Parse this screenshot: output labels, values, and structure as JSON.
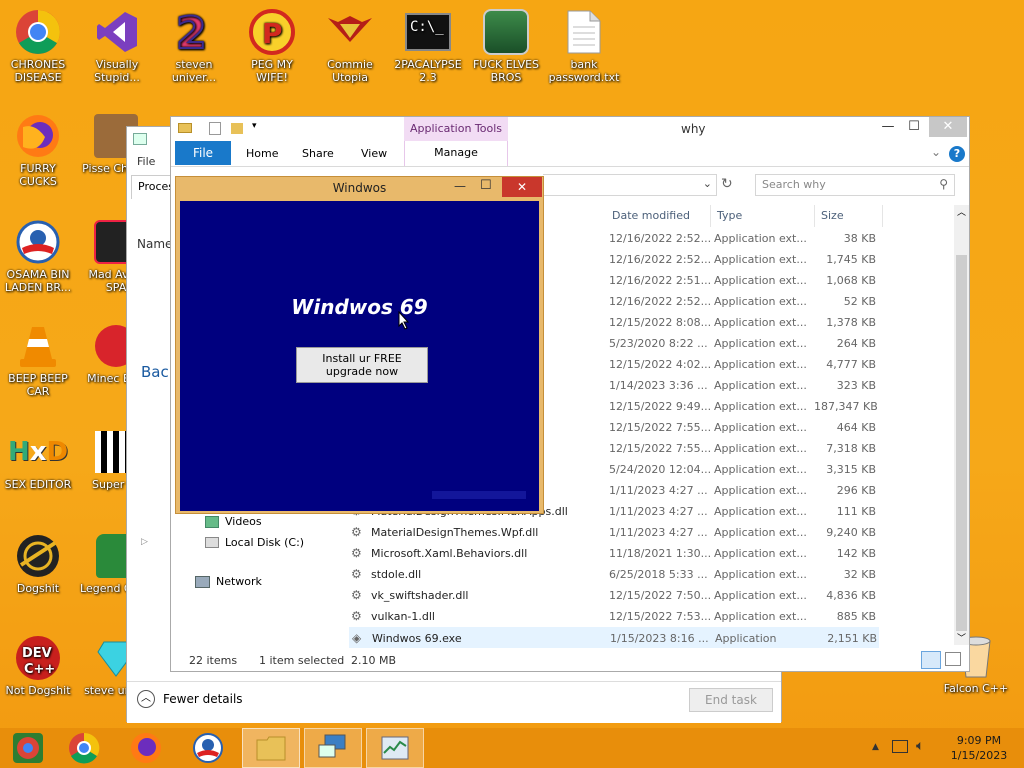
{
  "desktop": {
    "icons": [
      {
        "label": "CHRONES DISEASE"
      },
      {
        "label": "Visually Stupid..."
      },
      {
        "label": "steven univer..."
      },
      {
        "label": "PEG MY WIFE!"
      },
      {
        "label": "Commie Utopia"
      },
      {
        "label": "2PACALYPSE 2.3"
      },
      {
        "label": "FUCK ELVES BROS"
      },
      {
        "label": "bank password.txt"
      },
      {
        "label": "FURRY CUCKS"
      },
      {
        "label": "Pisse Chicke"
      },
      {
        "label": "OSAMA BIN LADEN BR..."
      },
      {
        "label": "Mad Av IN SPA"
      },
      {
        "label": "BEEP BEEP CAR"
      },
      {
        "label": "Minec Bird"
      },
      {
        "label": "SEX EDITOR"
      },
      {
        "label": "Super Cr"
      },
      {
        "label": "Dogshit"
      },
      {
        "label": "Legend CRYA"
      },
      {
        "label": "Not Dogshit"
      },
      {
        "label": "steve unive"
      },
      {
        "label": "Falcon C++"
      }
    ]
  },
  "explorer": {
    "title": "why",
    "context_tab": "Application Tools",
    "ribbon_tabs": {
      "file": "File",
      "home": "Home",
      "share": "Share",
      "view": "View",
      "manage": "Manage"
    },
    "search_placeholder": "Search why",
    "columns": {
      "date": "Date modified",
      "type": "Type",
      "size": "Size"
    },
    "rows": [
      {
        "name": "",
        "date": "12/16/2022 2:52...",
        "type": "Application ext...",
        "size": "38 KB"
      },
      {
        "name": "",
        "date": "12/16/2022 2:52...",
        "type": "Application ext...",
        "size": "1,745 KB"
      },
      {
        "name": "",
        "date": "12/16/2022 2:51...",
        "type": "Application ext...",
        "size": "1,068 KB"
      },
      {
        "name": "",
        "date": "12/16/2022 2:52...",
        "type": "Application ext...",
        "size": "52 KB"
      },
      {
        "name": "",
        "date": "12/15/2022 8:08...",
        "type": "Application ext...",
        "size": "1,378 KB"
      },
      {
        "name": "",
        "date": "5/23/2020 8:22 ...",
        "type": "Application ext...",
        "size": "264 KB"
      },
      {
        "name": "",
        "date": "12/15/2022 4:02...",
        "type": "Application ext...",
        "size": "4,777 KB"
      },
      {
        "name": "",
        "date": "1/14/2023 3:36 ...",
        "type": "Application ext...",
        "size": "323 KB"
      },
      {
        "name": "",
        "date": "12/15/2022 9:49...",
        "type": "Application ext...",
        "size": "187,347 KB"
      },
      {
        "name": "",
        "date": "12/15/2022 7:55...",
        "type": "Application ext...",
        "size": "464 KB"
      },
      {
        "name": "",
        "date": "12/15/2022 7:55...",
        "type": "Application ext...",
        "size": "7,318 KB"
      },
      {
        "name": "",
        "date": "5/24/2020 12:04...",
        "type": "Application ext...",
        "size": "3,315 KB"
      },
      {
        "name": "",
        "date": "1/11/2023 4:27 ...",
        "type": "Application ext...",
        "size": "296 KB"
      },
      {
        "name": "MaterialDesignThemes.MahApps.dll",
        "date": "1/11/2023 4:27 ...",
        "type": "Application ext...",
        "size": "111 KB"
      },
      {
        "name": "MaterialDesignThemes.Wpf.dll",
        "date": "1/11/2023 4:27 ...",
        "type": "Application ext...",
        "size": "9,240 KB"
      },
      {
        "name": "Microsoft.Xaml.Behaviors.dll",
        "date": "11/18/2021 1:30...",
        "type": "Application ext...",
        "size": "142 KB"
      },
      {
        "name": "stdole.dll",
        "date": "6/25/2018 5:33 ...",
        "type": "Application ext...",
        "size": "32 KB"
      },
      {
        "name": "vk_swiftshader.dll",
        "date": "12/15/2022 7:50...",
        "type": "Application ext...",
        "size": "4,836 KB"
      },
      {
        "name": "vulkan-1.dll",
        "date": "12/15/2022 7:53...",
        "type": "Application ext...",
        "size": "885 KB"
      },
      {
        "name": "Windwos 69.exe",
        "date": "1/15/2023 8:16 ...",
        "type": "Application",
        "size": "2,151 KB"
      }
    ],
    "nav": {
      "videos": "Videos",
      "local_disk": "Local Disk (C:)",
      "network": "Network"
    },
    "status": {
      "items": "22 items",
      "selected": "1 item selected",
      "size": "2.10 MB"
    }
  },
  "taskmgr": {
    "menu_file": "File",
    "tab_processes": "Proces",
    "col_name": "Name",
    "section_back": "Back",
    "fewer_details": "Fewer details",
    "end_task": "End task"
  },
  "popup": {
    "title": "Windwos",
    "heading": "Windwos 69",
    "button": "Install ur FREE upgrade now",
    "bg_color": "#00007f"
  },
  "taskbar": {
    "time": "9:09 PM",
    "date": "1/15/2023"
  }
}
